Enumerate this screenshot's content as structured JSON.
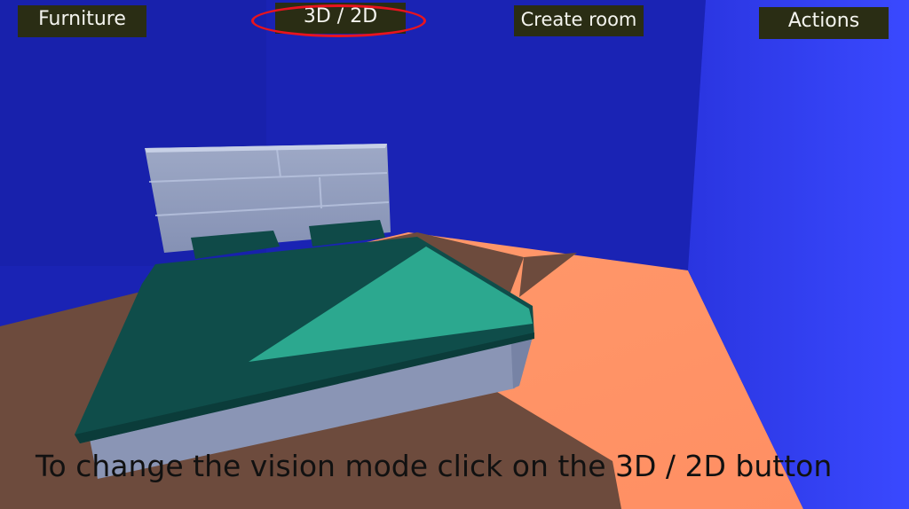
{
  "toolbar": {
    "furniture_label": "Furniture",
    "view_toggle_label": "3D / 2D",
    "create_room_label": "Create room",
    "actions_label": "Actions"
  },
  "tutorial": {
    "caption": "To change the vision mode click on the 3D / 2D button",
    "highlight_color": "#e8141e"
  },
  "scene": {
    "back_wall_color": "#1a23b4",
    "side_wall_color": "#2f3cf2",
    "floor_lit_color": "#ff9466",
    "floor_shadow_color": "#6b4a3c",
    "bed_frame_color": "#8c98b8",
    "blanket_color": "#0f4d4a",
    "blanket_lit_color": "#2ba88e"
  }
}
